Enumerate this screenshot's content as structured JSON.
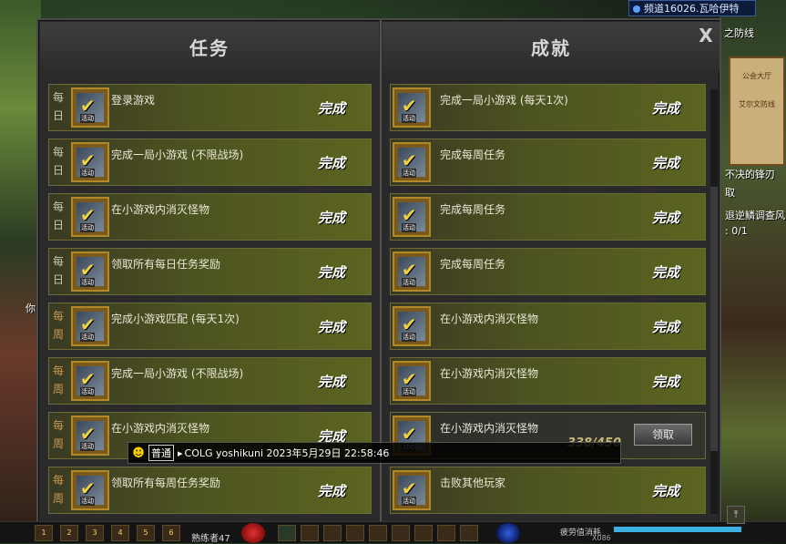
{
  "header": {
    "channel": "频道16026.瓦哈伊特",
    "close_label": "X"
  },
  "side": {
    "frag1": "之防线",
    "frag2": "公会大厅",
    "frag3": "艾尔文防线",
    "frag4": "不决的锋刃",
    "frag5": "取",
    "frag6": "退逆鳞调查风",
    "frag7": ": 0/1",
    "frag8": "你"
  },
  "tasks": {
    "heading": "任务",
    "items": [
      {
        "period": "每日",
        "title": "登录游戏",
        "status": "完成"
      },
      {
        "period": "每日",
        "title": "完成一局小游戏 (不限战场)",
        "status": "完成"
      },
      {
        "period": "每日",
        "title": "在小游戏内消灭怪物",
        "status": "完成"
      },
      {
        "period": "每日",
        "title": "领取所有每日任务奖励",
        "status": "完成"
      },
      {
        "period": "每周",
        "title": "完成小游戏匹配 (每天1次)",
        "status": "完成"
      },
      {
        "period": "每周",
        "title": "完成一局小游戏 (不限战场)",
        "status": "完成"
      },
      {
        "period": "每周",
        "title": "在小游戏内消灭怪物",
        "status": "完成"
      },
      {
        "period": "每周",
        "title": "领取所有每周任务奖励",
        "status": "完成"
      }
    ]
  },
  "achievements": {
    "heading": "成就",
    "items": [
      {
        "title": "完成一局小游戏 (每天1次)",
        "status": "完成"
      },
      {
        "title": "完成每周任务",
        "status": "完成"
      },
      {
        "title": "完成每周任务",
        "status": "完成"
      },
      {
        "title": "完成每周任务",
        "status": "完成"
      },
      {
        "title": "在小游戏内消灭怪物",
        "status": "完成"
      },
      {
        "title": "在小游戏内消灭怪物",
        "status": "完成"
      },
      {
        "title": "在小游戏内消灭怪物",
        "progress": "338/450",
        "button": "领取"
      },
      {
        "title": "击败其他玩家",
        "status": "完成"
      }
    ]
  },
  "icon_tag": "活动",
  "icon_tag_100": "100",
  "chat": {
    "channel": "普通",
    "message": "COLG yoshikuni 2023年5月29日 22:58:46"
  },
  "hotbar": {
    "slots": [
      "1",
      "2",
      "3",
      "4",
      "5",
      "6"
    ],
    "level_text": "熟练者47",
    "fatigue_text": "疲劳值消耗",
    "exp_label": "X086"
  }
}
